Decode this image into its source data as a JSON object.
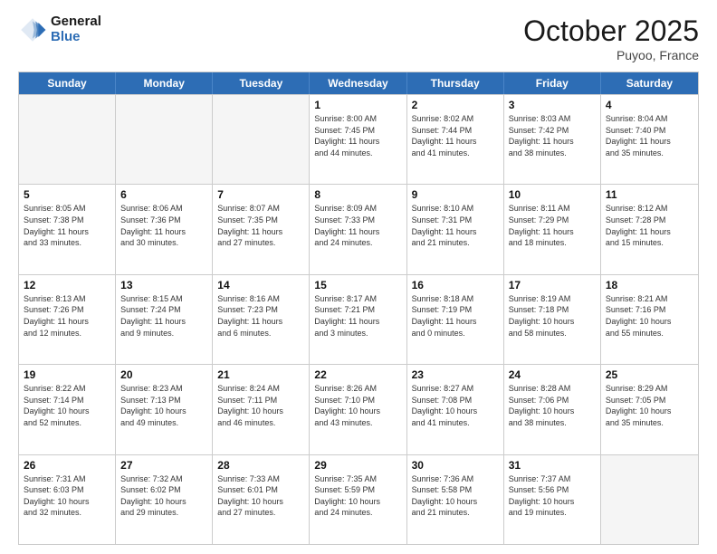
{
  "header": {
    "logo_line1": "General",
    "logo_line2": "Blue",
    "month": "October 2025",
    "location": "Puyoo, France"
  },
  "weekdays": [
    "Sunday",
    "Monday",
    "Tuesday",
    "Wednesday",
    "Thursday",
    "Friday",
    "Saturday"
  ],
  "rows": [
    [
      {
        "day": "",
        "info": ""
      },
      {
        "day": "",
        "info": ""
      },
      {
        "day": "",
        "info": ""
      },
      {
        "day": "1",
        "info": "Sunrise: 8:00 AM\nSunset: 7:45 PM\nDaylight: 11 hours\nand 44 minutes."
      },
      {
        "day": "2",
        "info": "Sunrise: 8:02 AM\nSunset: 7:44 PM\nDaylight: 11 hours\nand 41 minutes."
      },
      {
        "day": "3",
        "info": "Sunrise: 8:03 AM\nSunset: 7:42 PM\nDaylight: 11 hours\nand 38 minutes."
      },
      {
        "day": "4",
        "info": "Sunrise: 8:04 AM\nSunset: 7:40 PM\nDaylight: 11 hours\nand 35 minutes."
      }
    ],
    [
      {
        "day": "5",
        "info": "Sunrise: 8:05 AM\nSunset: 7:38 PM\nDaylight: 11 hours\nand 33 minutes."
      },
      {
        "day": "6",
        "info": "Sunrise: 8:06 AM\nSunset: 7:36 PM\nDaylight: 11 hours\nand 30 minutes."
      },
      {
        "day": "7",
        "info": "Sunrise: 8:07 AM\nSunset: 7:35 PM\nDaylight: 11 hours\nand 27 minutes."
      },
      {
        "day": "8",
        "info": "Sunrise: 8:09 AM\nSunset: 7:33 PM\nDaylight: 11 hours\nand 24 minutes."
      },
      {
        "day": "9",
        "info": "Sunrise: 8:10 AM\nSunset: 7:31 PM\nDaylight: 11 hours\nand 21 minutes."
      },
      {
        "day": "10",
        "info": "Sunrise: 8:11 AM\nSunset: 7:29 PM\nDaylight: 11 hours\nand 18 minutes."
      },
      {
        "day": "11",
        "info": "Sunrise: 8:12 AM\nSunset: 7:28 PM\nDaylight: 11 hours\nand 15 minutes."
      }
    ],
    [
      {
        "day": "12",
        "info": "Sunrise: 8:13 AM\nSunset: 7:26 PM\nDaylight: 11 hours\nand 12 minutes."
      },
      {
        "day": "13",
        "info": "Sunrise: 8:15 AM\nSunset: 7:24 PM\nDaylight: 11 hours\nand 9 minutes."
      },
      {
        "day": "14",
        "info": "Sunrise: 8:16 AM\nSunset: 7:23 PM\nDaylight: 11 hours\nand 6 minutes."
      },
      {
        "day": "15",
        "info": "Sunrise: 8:17 AM\nSunset: 7:21 PM\nDaylight: 11 hours\nand 3 minutes."
      },
      {
        "day": "16",
        "info": "Sunrise: 8:18 AM\nSunset: 7:19 PM\nDaylight: 11 hours\nand 0 minutes."
      },
      {
        "day": "17",
        "info": "Sunrise: 8:19 AM\nSunset: 7:18 PM\nDaylight: 10 hours\nand 58 minutes."
      },
      {
        "day": "18",
        "info": "Sunrise: 8:21 AM\nSunset: 7:16 PM\nDaylight: 10 hours\nand 55 minutes."
      }
    ],
    [
      {
        "day": "19",
        "info": "Sunrise: 8:22 AM\nSunset: 7:14 PM\nDaylight: 10 hours\nand 52 minutes."
      },
      {
        "day": "20",
        "info": "Sunrise: 8:23 AM\nSunset: 7:13 PM\nDaylight: 10 hours\nand 49 minutes."
      },
      {
        "day": "21",
        "info": "Sunrise: 8:24 AM\nSunset: 7:11 PM\nDaylight: 10 hours\nand 46 minutes."
      },
      {
        "day": "22",
        "info": "Sunrise: 8:26 AM\nSunset: 7:10 PM\nDaylight: 10 hours\nand 43 minutes."
      },
      {
        "day": "23",
        "info": "Sunrise: 8:27 AM\nSunset: 7:08 PM\nDaylight: 10 hours\nand 41 minutes."
      },
      {
        "day": "24",
        "info": "Sunrise: 8:28 AM\nSunset: 7:06 PM\nDaylight: 10 hours\nand 38 minutes."
      },
      {
        "day": "25",
        "info": "Sunrise: 8:29 AM\nSunset: 7:05 PM\nDaylight: 10 hours\nand 35 minutes."
      }
    ],
    [
      {
        "day": "26",
        "info": "Sunrise: 7:31 AM\nSunset: 6:03 PM\nDaylight: 10 hours\nand 32 minutes."
      },
      {
        "day": "27",
        "info": "Sunrise: 7:32 AM\nSunset: 6:02 PM\nDaylight: 10 hours\nand 29 minutes."
      },
      {
        "day": "28",
        "info": "Sunrise: 7:33 AM\nSunset: 6:01 PM\nDaylight: 10 hours\nand 27 minutes."
      },
      {
        "day": "29",
        "info": "Sunrise: 7:35 AM\nSunset: 5:59 PM\nDaylight: 10 hours\nand 24 minutes."
      },
      {
        "day": "30",
        "info": "Sunrise: 7:36 AM\nSunset: 5:58 PM\nDaylight: 10 hours\nand 21 minutes."
      },
      {
        "day": "31",
        "info": "Sunrise: 7:37 AM\nSunset: 5:56 PM\nDaylight: 10 hours\nand 19 minutes."
      },
      {
        "day": "",
        "info": ""
      }
    ]
  ]
}
